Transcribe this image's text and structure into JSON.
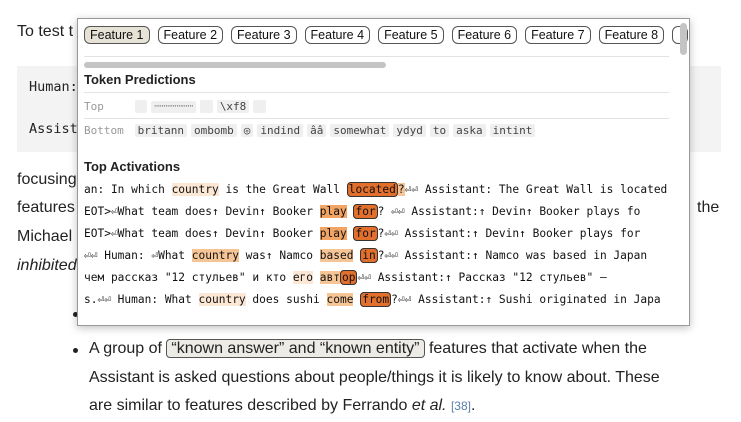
{
  "background": {
    "intro_prefix": "To test t",
    "code_line_1": "Human:",
    "code_line_2": "Assist",
    "para_lines": [
      "focusing",
      "features",
      "Michael",
      "inhibited"
    ],
    "right_the": "the"
  },
  "popup": {
    "tabs": [
      "Feature 1",
      "Feature 2",
      "Feature 3",
      "Feature 4",
      "Feature 5",
      "Feature 6",
      "Feature 7",
      "Feature 8"
    ],
    "active_tab": 0,
    "token_predictions_title": "Token Predictions",
    "top_label": "Top",
    "top_tokens": [
      "",
      "ꞏꞏꞏꞏꞏꞏꞏꞏꞏꞏꞏꞏꞏꞏꞏꞏꞏꞏꞏꞏꞏ",
      "",
      "\\xf8",
      ""
    ],
    "bottom_label": "Bottom",
    "bottom_tokens": [
      "britann",
      "ombomb",
      "◎",
      "indind",
      "ââ",
      "somewhat",
      "ydyd",
      "to",
      "aska",
      "intint"
    ],
    "top_activations_title": "Top Activations",
    "activations": [
      [
        [
          "an: In which ",
          ""
        ],
        [
          "country",
          "h1"
        ],
        [
          " is the Great Wall ",
          ""
        ],
        [
          "located",
          "max"
        ],
        [
          "?",
          "h2"
        ],
        [
          "⏎⏎ Assistant: The Great Wall is located",
          ""
        ]
      ],
      [
        [
          "EOT>⏎What team does↑ Devin↑ Booker ",
          ""
        ],
        [
          "play",
          "h3"
        ],
        [
          " ",
          ""
        ],
        [
          "for",
          "max"
        ],
        [
          "? ⏎⏎ Assistant:↑ Devin↑ Booker plays fo",
          ""
        ]
      ],
      [
        [
          "EOT>⏎What team does↑ Devin↑ Booker ",
          ""
        ],
        [
          "play",
          "h3"
        ],
        [
          " ",
          ""
        ],
        [
          "for",
          "max"
        ],
        [
          "?⏎⏎ Assistant:↑ Devin↑ Booker plays for",
          ""
        ]
      ],
      [
        [
          "⏎⏎ Human: ⏎What ",
          ""
        ],
        [
          "country",
          "h2"
        ],
        [
          " was↑ Namco ",
          ""
        ],
        [
          "based",
          "h2"
        ],
        [
          " ",
          ""
        ],
        [
          "in",
          "max"
        ],
        [
          "?⏎⏎ Assistant:↑ Namco was based in Japan",
          ""
        ]
      ],
      [
        [
          "чем рассказ \"12 стульев\" и кто ",
          ""
        ],
        [
          "его",
          "h1"
        ],
        [
          " ",
          ""
        ],
        [
          "авт",
          "h2"
        ],
        [
          "ор",
          "max"
        ],
        [
          "⏎⏎ Assistant:↑ Рассказ \"12 стульев\" –",
          ""
        ]
      ],
      [
        [
          "s.⏎⏎ Human: What ",
          ""
        ],
        [
          "country",
          "h1"
        ],
        [
          " does sushi ",
          ""
        ],
        [
          "come",
          "h2"
        ],
        [
          " ",
          ""
        ],
        [
          "from",
          "max"
        ],
        [
          "?⏎⏎ Assistant:↑ Sushi originated in Japa",
          ""
        ]
      ]
    ]
  },
  "bullets": {
    "item2_prefix": "A group of ",
    "item2_boxed": "“known answer” and “known entity”",
    "item2_line1_suffix": " features that activate when the",
    "item2_line2": "Assistant is asked questions about people/things it is likely to know about. These",
    "item2_line3_prefix": "are similar to features described by Ferrando ",
    "item2_line3_italic": "et al.",
    "item2_cite": "[38]",
    "item2_end": "."
  }
}
